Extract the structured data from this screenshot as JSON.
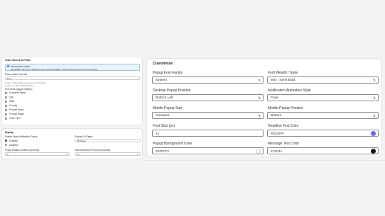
{
  "left_top": {
    "title": "Order Source & Fields",
    "banner_title": "You need an orders",
    "banner_text": "We update orders from Shopify for the selected variables. Orders without products are not counted.",
    "source_label": "Show orders from last",
    "source_value": "Day",
    "source_help": "1 Day = Today (shop timezone), up to 60 days",
    "help_link": "Learn more about order statuses",
    "hide_label": "Hide fields (toggle visibility)",
    "fields": [
      "Customer Name",
      "City",
      "State",
      "Country",
      "Product Name",
      "Product Image",
      "Order Time"
    ]
  },
  "left_bottom": {
    "title": "Display",
    "enable_label": "Enable Sales Notification Popup",
    "enabled_option": "Enabled",
    "disabled_option": "Disabled",
    "pages_label": "Display On Pages",
    "pages_value": "All Pages",
    "duration_label": "Popup Display Duration (seconds)",
    "duration_value": "8",
    "interval_label": "Interval Between Popups (seconds)",
    "interval_value": "10"
  },
  "customize": {
    "title": "Customize",
    "fields": [
      {
        "label": "Popup Font Family",
        "value": "System",
        "kind": "select"
      },
      {
        "label": "Font Weight / Style",
        "value": "600 - Semi Bold",
        "kind": "select"
      },
      {
        "label": "Desktop Popup Position",
        "value": "Bottom Left",
        "kind": "select"
      },
      {
        "label": "Notification Animation Style",
        "value": "Fade",
        "kind": "select"
      },
      {
        "label": "Mobile Popup Size",
        "value": "Compact",
        "kind": "select"
      },
      {
        "label": "Mobile Popup Position",
        "value": "Bottom",
        "kind": "select"
      },
      {
        "label": "Font Size (px)",
        "value": "14",
        "kind": "input"
      },
      {
        "label": "Headline Text Color",
        "value": "#6C62FF",
        "kind": "color",
        "swatch": "#6c62ff"
      },
      {
        "label": "Popup Background Color",
        "value": "#FFFFFF",
        "kind": "color",
        "swatch": "#ffffff"
      },
      {
        "label": "Message Text Color",
        "value": "#111111",
        "kind": "color",
        "swatch": "#111111"
      }
    ]
  }
}
